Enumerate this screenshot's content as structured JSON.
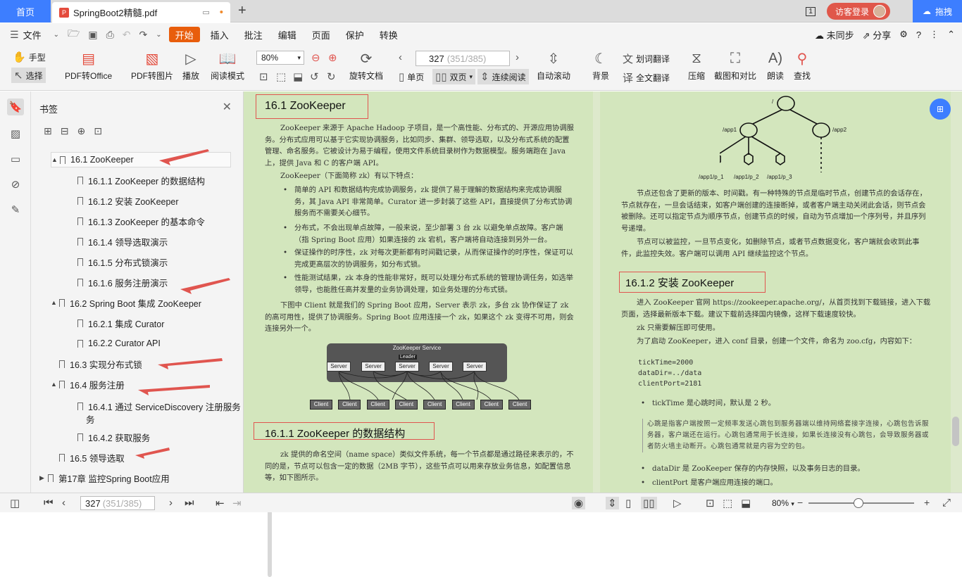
{
  "tabs": {
    "home": "首页",
    "doc": "SpringBoot2精髓.pdf",
    "new": "+"
  },
  "topright": {
    "login": "访客登录",
    "drag": "拖拽"
  },
  "menu": {
    "file": "文件",
    "items": [
      "开始",
      "插入",
      "批注",
      "编辑",
      "页面",
      "保护",
      "转换"
    ],
    "unsynced": "未同步",
    "share": "分享"
  },
  "ribbon": {
    "hand": "手型",
    "select": "选择",
    "pdf_office": "PDF转Office",
    "pdf_img": "PDF转图片",
    "play": "播放",
    "read_mode": "阅读模式",
    "zoom": "80%",
    "rotate": "旋转文档",
    "page_current": "327",
    "page_total": "(351/385)",
    "single": "单页",
    "double": "双页",
    "continuous": "连续阅读",
    "autoscroll": "自动滚动",
    "background": "背景",
    "translate": "划词翻译",
    "full_translate": "全文翻译",
    "compress": "压缩",
    "screenshot": "截图和对比",
    "read_aloud": "朗读",
    "search": "查找"
  },
  "bookmarks": {
    "title": "书签",
    "items": [
      {
        "label": "16.1 ZooKeeper",
        "level": 1,
        "toggle": "▲"
      },
      {
        "label": "16.1.1 ZooKeeper 的数据结构",
        "level": 2
      },
      {
        "label": "16.1.2 安装 ZooKeeper",
        "level": 2
      },
      {
        "label": "16.1.3 ZooKeeper 的基本命令",
        "level": 2
      },
      {
        "label": "16.1.4 领导选取演示",
        "level": 2
      },
      {
        "label": "16.1.5 分布式锁演示",
        "level": 2
      },
      {
        "label": "16.1.6 服务注册演示",
        "level": 2
      },
      {
        "label": "16.2 Spring Boot 集成 ZooKeeper",
        "level": 1,
        "toggle": "▲"
      },
      {
        "label": "16.2.1 集成 Curator",
        "level": 2
      },
      {
        "label": "16.2.2 Curator API",
        "level": 2
      },
      {
        "label": "16.3 实现分布式锁",
        "level": 1
      },
      {
        "label": "16.4 服务注册",
        "level": 1,
        "toggle": "▲"
      },
      {
        "label": "16.4.1 通过 ServiceDiscovery 注册服务",
        "level": 2,
        "line2": "务"
      },
      {
        "label": "16.4.2 获取服务",
        "level": 2
      },
      {
        "label": "16.5 领导选取",
        "level": 1
      },
      {
        "label": "第17章 监控Spring Boot应用",
        "level": 0,
        "toggle": "▶"
      }
    ]
  },
  "doc_left": {
    "h_zk": "16.1   ZooKeeper",
    "p1": "ZooKeeper 来源于 Apache Hadoop 子项目，是一个高性能、分布式的、开源应用协调服务。分布式应用可以基于它实现协调服务，比如同步、集群、领导选取，以及分布式系统的配置管理、命名服务。它被设计为易于编程，使用文件系统目录树作为数据模型。服务端跑在 Java 上，提供 Java 和 C 的客户端 API。",
    "p2": "ZooKeeper（下面简称 zk）有以下特点：",
    "bullets": [
      "简单的 API 和数据结构完成协调服务，zk 提供了易于理解的数据结构来完成协调服务，其 Java API 非常简单。Curator 进一步封装了这些 API，直接提供了分布式协调服务而不需要关心细节。",
      "分布式，不会出现单点故障，一般来说，至少部署 3 台 zk 以避免单点故障。客户端（指 Spring Boot 应用）如果连接的 zk 宕机，客户端将自动连接到另外一台。",
      "保证操作的时序性，zk 对每次更新都有时间戳记录，从而保证操作的时序性，保证可以完成更高层次的协调服务，如分布式锁。",
      "性能测试结果，zk 本身的性能非常好，既可以处理分布式系统的管理协调任务，如选举领导，也能胜任高并发量的业务协调处理，如业务处理的分布式锁。"
    ],
    "p3": "下图中 Client 就是我们的 Spring Boot 应用，Server 表示 zk，多台 zk 协作保证了 zk 的高可用性，提供了协调服务。Spring Boot 应用连接一个 zk，如果这个 zk 变得不可用，则会连接另外一个。",
    "diagram": {
      "title": "ZooKeeper Service",
      "leader": "Leader",
      "server": "Server",
      "client": "Client"
    },
    "h_ds": "16.1.1   ZooKeeper 的数据结构",
    "p4": "zk 提供的命名空间（name space）类似文件系统，每一个节点都是通过路径来表示的，不同的是，节点可以包含一定的数据（2MB 字节），这些节点可以用来存放业务信息，如配置信息等，如下图所示。"
  },
  "doc_right": {
    "tree": {
      "root": "/",
      "app1": "/app1",
      "app2": "/app2",
      "c1": "/app1/p_1",
      "c2": "/app1/p_2",
      "c3": "/app1/p_3"
    },
    "p1": "节点还包含了更新的版本、时间戳。有一种特殊的节点是临时节点，创建节点的会话存在，节点就存在，一旦会话结束，如客户端创建的连接断掉，或者客户端主动关闭此会话，则节点会被删除。还可以指定节点为顺序节点，创建节点的时候，自动为节点增加一个序列号，并且序列号递增。",
    "p2": "节点可以被监控，一旦节点变化，如删除节点，或者节点数据变化，客户端就会收到此事件，此监控失效。客户端可以调用 API 继续监控这个节点。",
    "h_install": "16.1.2   安装 ZooKeeper",
    "p3": "进入 ZooKeeper 官网 https://zookeeper.apache.org/，从首页找到下载链接，进入下载页面，选择最新版本下载。建议下载前选择国内镜像，这样下载速度较快。",
    "p4": "zk 只需要解压即可使用。",
    "p5": "为了启动 ZooKeeper，进入 conf 目录，创建一个文件，命名为 zoo.cfg，内容如下：",
    "code": [
      "tickTime=2000",
      "dataDir=../data",
      "clientPort=2181"
    ],
    "b1": "tickTime 是心跳时间，默认是 2 秒。",
    "quote": "心跳是指客户端按照一定频率发送心跳包到服务器端以维持网络套接字连接，心跳包告诉服务器，客户端还在运行。心跳包通常用于长连接，如果长连接没有心跳包，会导致服务器或者防火墙主动断开。心跳包通常就是内容为空的包。",
    "b2": "dataDir 是 ZooKeeper 保存的内存快照，以及事务日志的目录。",
    "b3": "clientPort 是客户端应用连接的端口。"
  },
  "status": {
    "page": "327",
    "page_total": "(351/385)",
    "zoom": "80%"
  },
  "colors": {
    "accent": "#3d7eff",
    "menu_active": "#e85d0c",
    "page_bg": "#d3e6bd",
    "annotation": "#e0554f"
  }
}
